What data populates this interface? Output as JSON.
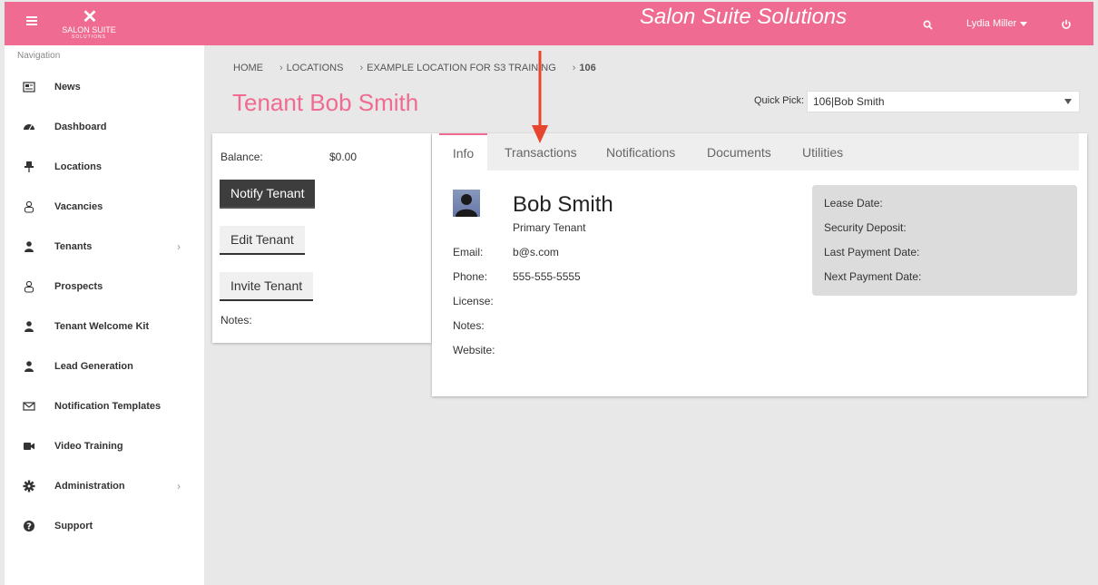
{
  "header": {
    "title": "Salon Suite Solutions",
    "logo_text": "SALON SUITE",
    "logo_sub": "SOLUTIONS",
    "user_name": "Lydia Miller",
    "brand_color": "#f06b91"
  },
  "sidebar": {
    "heading": "Navigation",
    "items": [
      {
        "label": "News",
        "icon": "newspaper-icon"
      },
      {
        "label": "Dashboard",
        "icon": "dashboard-icon"
      },
      {
        "label": "Locations",
        "icon": "pin-icon"
      },
      {
        "label": "Vacancies",
        "icon": "user-outline-icon"
      },
      {
        "label": "Tenants",
        "icon": "user-icon"
      },
      {
        "label": "Prospects",
        "icon": "user-outline-icon"
      },
      {
        "label": "Tenant Welcome Kit",
        "icon": "user-icon"
      },
      {
        "label": "Lead Generation",
        "icon": "user-icon"
      },
      {
        "label": "Notification Templates",
        "icon": "envelope-icon"
      },
      {
        "label": "Video Training",
        "icon": "video-icon"
      },
      {
        "label": "Administration",
        "icon": "gear-icon"
      },
      {
        "label": "Support",
        "icon": "question-icon"
      }
    ]
  },
  "breadcrumb": [
    "HOME",
    "LOCATIONS",
    "EXAMPLE LOCATION FOR S3 TRAINING",
    "106"
  ],
  "page": {
    "title": "Tenant Bob Smith",
    "quick_pick_label": "Quick Pick:",
    "quick_pick_value": "106|Bob Smith"
  },
  "summary": {
    "balance_label": "Balance:",
    "balance_value": "$0.00",
    "notify_button": "Notify Tenant",
    "edit_button": "Edit Tenant",
    "invite_button": "Invite Tenant",
    "notes_label": "Notes:"
  },
  "tabs": [
    "Info",
    "Transactions",
    "Notifications",
    "Documents",
    "Utilities"
  ],
  "info": {
    "name": "Bob Smith",
    "role": "Primary Tenant",
    "fields": [
      {
        "label": "Email:",
        "value": "b@s.com"
      },
      {
        "label": "Phone:",
        "value": "555-555-5555"
      },
      {
        "label": "License:",
        "value": ""
      },
      {
        "label": "Notes:",
        "value": ""
      },
      {
        "label": "Website:",
        "value": ""
      }
    ],
    "lease": [
      "Lease Date:",
      "Security Deposit:",
      "Last Payment Date:",
      "Next Payment Date:"
    ]
  }
}
